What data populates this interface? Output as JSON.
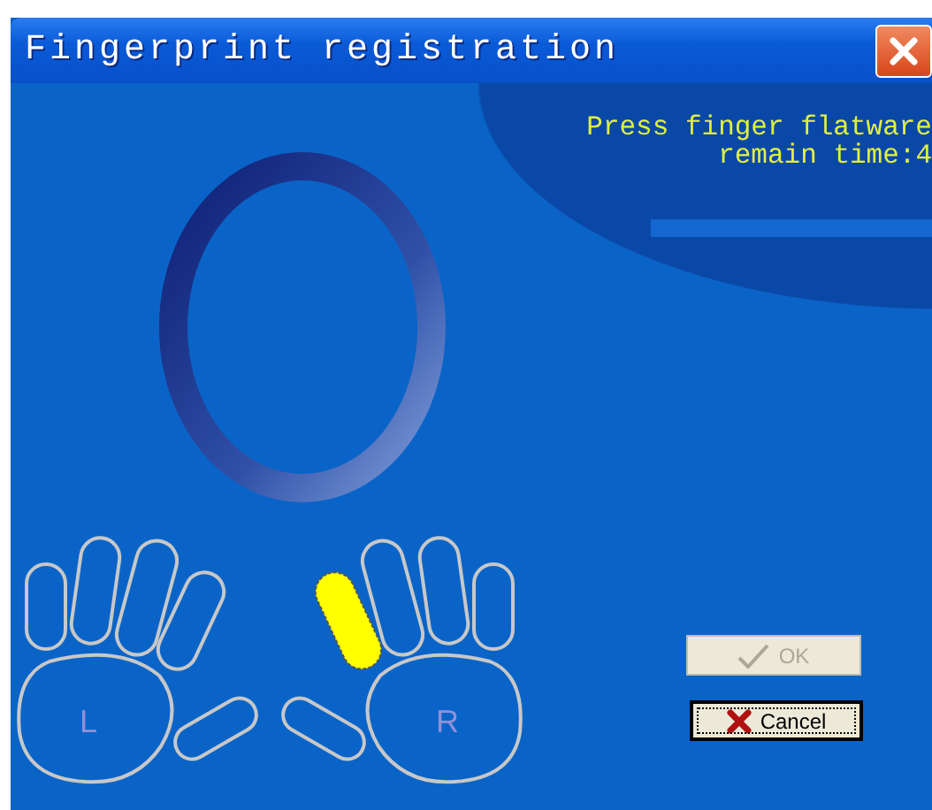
{
  "window": {
    "title": "Fingerprint registration"
  },
  "message": {
    "lines": [
      "Press finger flatware",
      "remain time:4"
    ]
  },
  "progress": {
    "level": 1
  },
  "hands": [
    {
      "label": "L",
      "fingers": [
        {
          "selected": false
        },
        {
          "selected": false
        },
        {
          "selected": false
        },
        {
          "selected": false
        },
        {
          "selected": false
        }
      ]
    },
    {
      "label": "R",
      "fingers": [
        {
          "selected": false
        },
        {
          "selected": false
        },
        {
          "selected": false
        },
        {
          "selected": true
        },
        {
          "selected": false
        }
      ]
    }
  ],
  "buttons": [
    {
      "label": "OK",
      "kind": "check",
      "disabled": true,
      "focused": false
    },
    {
      "label": "Cancel",
      "kind": "cross",
      "disabled": false,
      "focused": true
    }
  ]
}
